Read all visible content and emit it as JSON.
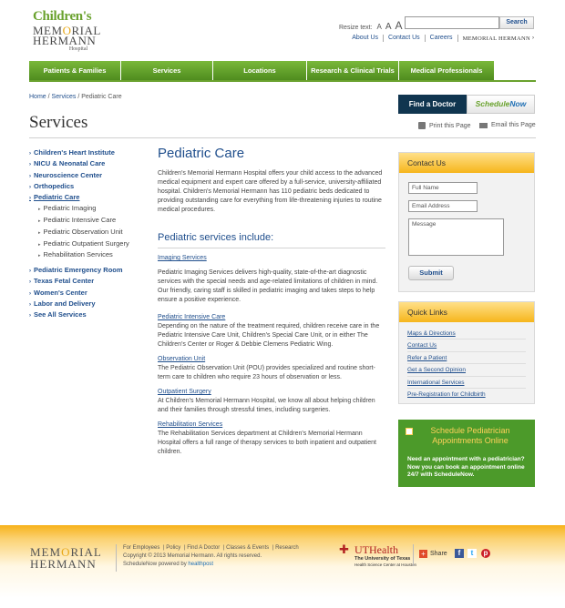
{
  "header": {
    "logo": {
      "line1": "Children's",
      "line2a": "MEM",
      "line2b": "O",
      "line2c": "RIAL",
      "line2d": "HERMANN",
      "line3": "Hospital"
    },
    "resize_label": "Resize text:",
    "resize_a": [
      "A",
      "A",
      "A"
    ],
    "search_button": "Search",
    "search_value": "",
    "utility_links": [
      "About Us",
      "Contact Us",
      "Careers"
    ],
    "utility_brand": "MEMORIAL HERMANN"
  },
  "nav": {
    "items": [
      "Patients & Families",
      "Services",
      "Locations",
      "Research & Clinical Trials",
      "Medical Professionals"
    ]
  },
  "breadcrumb": {
    "home": "Home",
    "sep": "/",
    "services": "Services",
    "current": "Pediatric Care"
  },
  "page_title": "Services",
  "actions": {
    "find_doctor": "Find a Doctor",
    "schedule_a": "Schedule",
    "schedule_b": "Now",
    "print": "Print this Page",
    "email": "Email this Page"
  },
  "sidebar": {
    "items_top": [
      "Children's Heart Institute",
      "NICU & Neonatal Care",
      "Neuroscience Center",
      "Orthopedics",
      "Pediatric Care"
    ],
    "sub_items": [
      "Pediatric Imaging",
      "Pediatric Intensive Care",
      "Pediatric Observation Unit",
      "Pediatric Outpatient Surgery",
      "Rehabilitation Services"
    ],
    "items_bottom": [
      "Pediatric Emergency Room",
      "Texas Fetal Center",
      "Women's Center",
      "Labor and Delivery",
      "See All Services"
    ]
  },
  "main": {
    "heading": "Pediatric Care",
    "intro": "Children's Memorial Hermann Hospital offers your child access to the advanced medical equipment and expert care offered by a full-service, university-affiliated hospital. Children's Memorial Hermann has 110 pediatric beds dedicated to providing outstanding care for everything from life-threatening injuries to routine medical procedures.",
    "services_heading": "Pediatric services include:",
    "services": [
      {
        "name": "Imaging Services",
        "text": "Pediatric Imaging Services delivers high-quality, state-of-the-art diagnostic services with the special needs and age-related limitations of children in mind. Our friendly, caring staff is skilled in pediatric imaging and takes steps to help ensure a positive experience."
      },
      {
        "name": "Pediatric Intensive Care",
        "text": "Depending on the nature of the treatment required, children receive care in the Pediatric Intensive Care Unit, Children's Special Care Unit, or in either The Children's Center or Roger & Debbie Clemens Pediatric Wing."
      },
      {
        "name": "Observation Unit",
        "text": "The Pediatric Observation Unit (POU) provides specialized and routine short-term care to children who require 23 hours of observation or less."
      },
      {
        "name": "Outpatient Surgery",
        "text": "At Children's Memorial Hermann Hospital, we know all about helping children and their families through stressful times, including surgeries."
      },
      {
        "name": "Rehabilitation Services",
        "text": "The Rehabilitation Services department at Children's Memorial Hermann Hospital offers a full range of therapy services to both inpatient and outpatient children."
      }
    ]
  },
  "contact": {
    "title": "Contact Us",
    "full_name": "Full Name",
    "email": "Email Address",
    "message": "Message",
    "submit": "Submit"
  },
  "quick_links": {
    "title": "Quick Links",
    "links": [
      "Maps & Directions",
      "Contact Us",
      "Refer a Patient",
      "Get a Second Opinion",
      "International Services",
      "Pre-Registration for Childbirth"
    ]
  },
  "schedule_box": {
    "title": "Schedule Pediatrician Appointments Online",
    "text": "Need an appointment with a pediatrician? Now you can book an appointment online 24/7 with ScheduleNow."
  },
  "footer": {
    "logo_a": "MEM",
    "logo_b": "O",
    "logo_c": "RIAL",
    "logo_d": "HERMANN",
    "links": [
      "For Employees",
      "|",
      "Policy",
      "|",
      "Find A Doctor",
      "|",
      "Classes & Events",
      "|",
      "Research"
    ],
    "copyright": "Copyright © 2013 Memorial Hermann. All rights reserved.",
    "powered": "ScheduleNow powered by",
    "powered_brand": "healthpost",
    "uth_a": "UT",
    "uth_b": "Health",
    "uth_sub1": "The University of Texas",
    "uth_sub2": "Health Science Center at Houston",
    "share": "Share"
  },
  "colors": {
    "green": "#6aa22e",
    "navy": "#10354f",
    "link": "#1f4e8c",
    "orange": "#f6b51c"
  }
}
